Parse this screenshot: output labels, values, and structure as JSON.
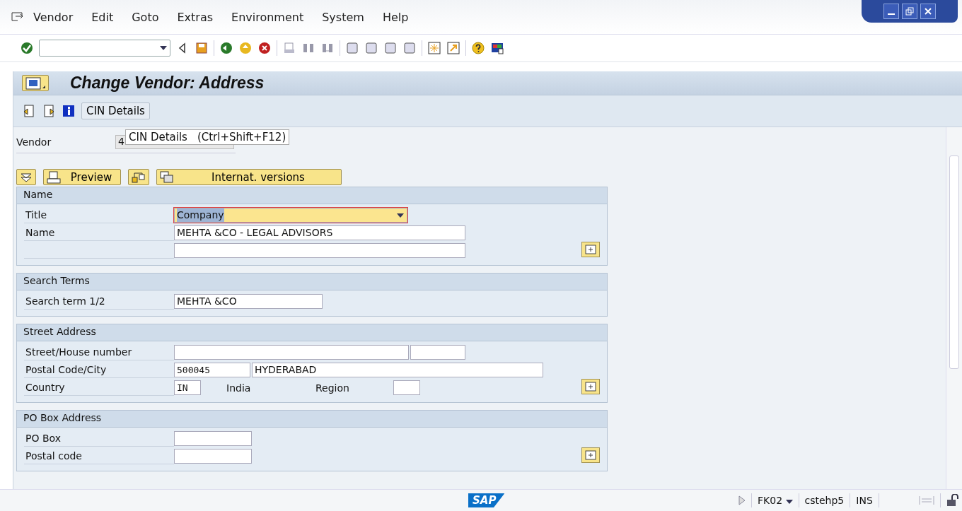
{
  "menu": [
    "Vendor",
    "Edit",
    "Goto",
    "Extras",
    "Environment",
    "System",
    "Help"
  ],
  "title": "Change Vendor: Address",
  "app_toolbar": {
    "button": "CIN Details"
  },
  "tooltip": {
    "text": "CIN Details",
    "shortcut": "(Ctrl+Shift+F12)"
  },
  "vendor": {
    "label": "Vendor",
    "value": "4"
  },
  "buttons": {
    "preview": "Preview",
    "versions": "Internat. versions"
  },
  "name_group": {
    "title": "Name",
    "title_label": "Title",
    "title_value": "Company",
    "name_label": "Name",
    "name_value": "MEHTA &CO - LEGAL ADVISORS"
  },
  "search_group": {
    "title": "Search Terms",
    "label": "Search term 1/2",
    "value": "MEHTA &CO"
  },
  "street_group": {
    "title": "Street Address",
    "street_label": "Street/House number",
    "postal_label": "Postal Code/City",
    "postal_code": "500045",
    "city": "HYDERABAD",
    "country_label": "Country",
    "country_code": "IN",
    "country_name": "India",
    "region_label": "Region"
  },
  "po_group": {
    "title": "PO Box Address",
    "po_box_label": "PO Box",
    "postal_label": "Postal code"
  },
  "status_bar": {
    "logo": "SAP",
    "transaction": "FK02",
    "server": "cstehp5",
    "mode": "INS"
  }
}
